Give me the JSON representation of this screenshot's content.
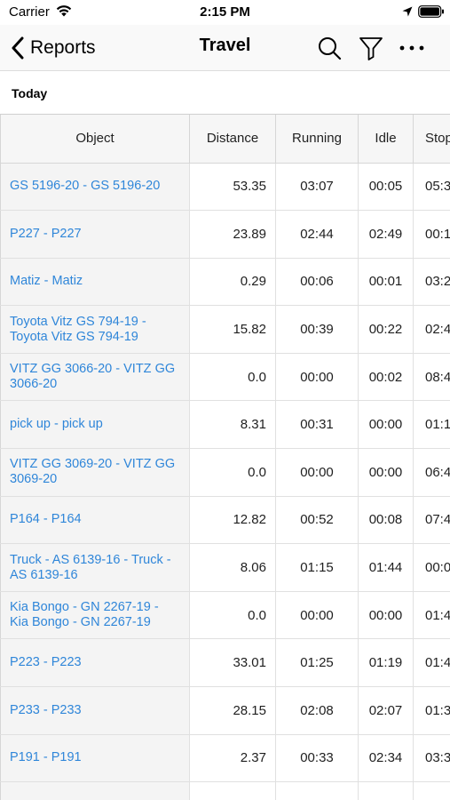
{
  "status_bar": {
    "carrier": "Carrier",
    "time": "2:15 PM"
  },
  "nav": {
    "back_label": "Reports",
    "title": "Travel",
    "icons": [
      "search-icon",
      "filter-icon",
      "more-icon"
    ]
  },
  "section": {
    "label": "Today"
  },
  "table": {
    "headers": {
      "object": "Object",
      "distance": "Distance",
      "running": "Running",
      "idle": "Idle",
      "stop": "Stop"
    },
    "rows": [
      {
        "object": "GS 5196-20 - GS 5196-20",
        "distance": "53.35",
        "running": "03:07",
        "idle": "00:05",
        "stop": "05:3"
      },
      {
        "object": "P227 - P227",
        "distance": "23.89",
        "running": "02:44",
        "idle": "02:49",
        "stop": "00:1"
      },
      {
        "object": "Matiz - Matiz",
        "distance": "0.29",
        "running": "00:06",
        "idle": "00:01",
        "stop": "03:2"
      },
      {
        "object": "Toyota Vitz GS 794-19 - Toyota Vitz GS 794-19",
        "distance": "15.82",
        "running": "00:39",
        "idle": "00:22",
        "stop": "02:4"
      },
      {
        "object": "VITZ GG 3066-20 - VITZ GG 3066-20",
        "distance": "0.0",
        "running": "00:00",
        "idle": "00:02",
        "stop": "08:4"
      },
      {
        "object": "pick up - pick up",
        "distance": "8.31",
        "running": "00:31",
        "idle": "00:00",
        "stop": "01:1"
      },
      {
        "object": "VITZ GG 3069-20 - VITZ GG 3069-20",
        "distance": "0.0",
        "running": "00:00",
        "idle": "00:00",
        "stop": "06:4"
      },
      {
        "object": "P164 - P164",
        "distance": "12.82",
        "running": "00:52",
        "idle": "00:08",
        "stop": "07:4"
      },
      {
        "object": "Truck - AS 6139-16 - Truck - AS 6139-16",
        "distance": "8.06",
        "running": "01:15",
        "idle": "01:44",
        "stop": "00:0"
      },
      {
        "object": "Kia Bongo - GN 2267-19 - Kia Bongo - GN 2267-19",
        "distance": "0.0",
        "running": "00:00",
        "idle": "00:00",
        "stop": "01:4"
      },
      {
        "object": "P223 - P223",
        "distance": "33.01",
        "running": "01:25",
        "idle": "01:19",
        "stop": "01:4"
      },
      {
        "object": "P233 - P233",
        "distance": "28.15",
        "running": "02:08",
        "idle": "02:07",
        "stop": "01:3"
      },
      {
        "object": "P191 - P191",
        "distance": "2.37",
        "running": "00:33",
        "idle": "02:34",
        "stop": "03:3"
      },
      {
        "object": "",
        "distance": "",
        "running": "",
        "idle": "",
        "stop": ""
      }
    ]
  },
  "colors": {
    "link": "#2f86d9",
    "nav_background": "#f9f9f9",
    "object_column_background": "#f4f4f4"
  }
}
